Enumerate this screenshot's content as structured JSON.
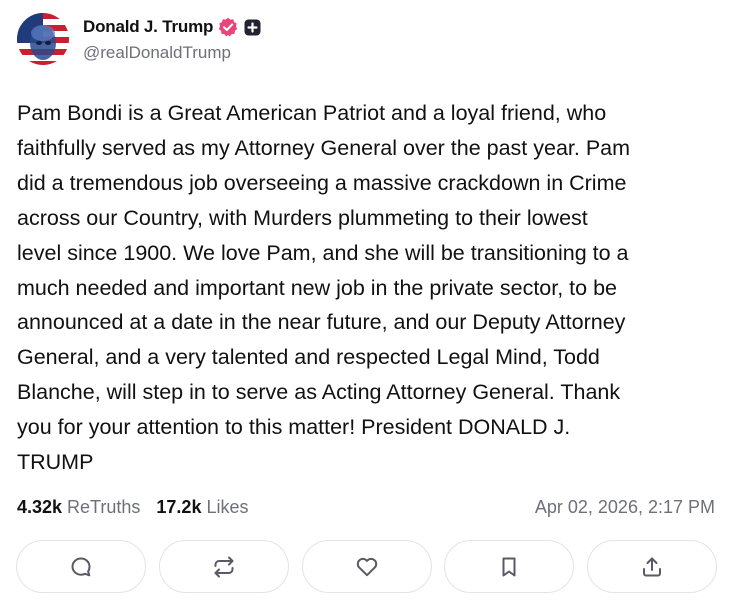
{
  "author": {
    "display_name": "Donald J. Trump",
    "handle": "@realDonaldTrump",
    "verified_color": "#e8457a"
  },
  "post": {
    "text": "Pam Bondi is a Great American Patriot and a loyal friend, who\nfaithfully served as my Attorney General over the past year. Pam\ndid a tremendous job overseeing a massive crackdown in Crime\nacross our Country, with Murders plummeting to their lowest\nlevel since 1900. We love Pam, and she will be transitioning to a\nmuch needed and important new job in the private sector, to be\nannounced at a date in the near future, and our Deputy Attorney\nGeneral, and a very talented and respected Legal Mind, Todd\nBlanche, will step in to serve as Acting Attorney General. Thank\nyou for your attention to this matter! President DONALD J.\nTRUMP"
  },
  "stats": {
    "retruths_count": "4.32k",
    "retruths_label": "ReTruths",
    "likes_count": "17.2k",
    "likes_label": "Likes",
    "timestamp": "Apr 02, 2026, 2:17 PM"
  },
  "actions": [
    {
      "icon": "reply-icon"
    },
    {
      "icon": "retruth-icon"
    },
    {
      "icon": "like-icon"
    },
    {
      "icon": "bookmark-icon"
    },
    {
      "icon": "share-icon"
    }
  ],
  "colors": {
    "muted_text": "#6f6f7a",
    "icon": "#5a5a66",
    "button_border": "#e3e3e8"
  }
}
